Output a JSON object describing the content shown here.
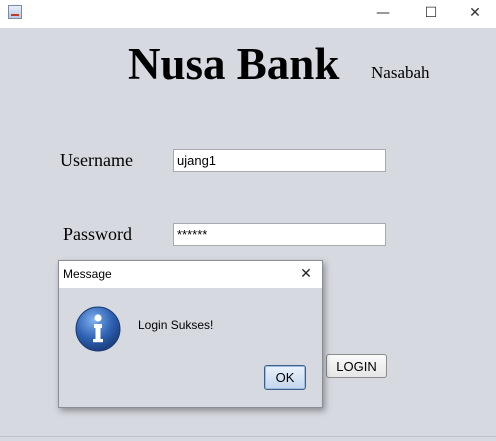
{
  "window": {
    "minimize_glyph": "—",
    "maximize_glyph": "☐",
    "close_glyph": "✕",
    "icon": "java-app-icon"
  },
  "app": {
    "title": "Nusa Bank",
    "subtitle": "Nasabah"
  },
  "form": {
    "username_label": "Username",
    "username_value": "ujang1",
    "password_label": "Password",
    "password_value": "******",
    "login_label": "LOGIN"
  },
  "dialog": {
    "title": "Message",
    "close_glyph": "✕",
    "message": "Login Sukses!",
    "ok_label": "OK",
    "icon": "info-icon"
  },
  "colors": {
    "background": "#d6d9e0",
    "titlebar": "#ffffff",
    "info_icon": "#2f62b3"
  }
}
